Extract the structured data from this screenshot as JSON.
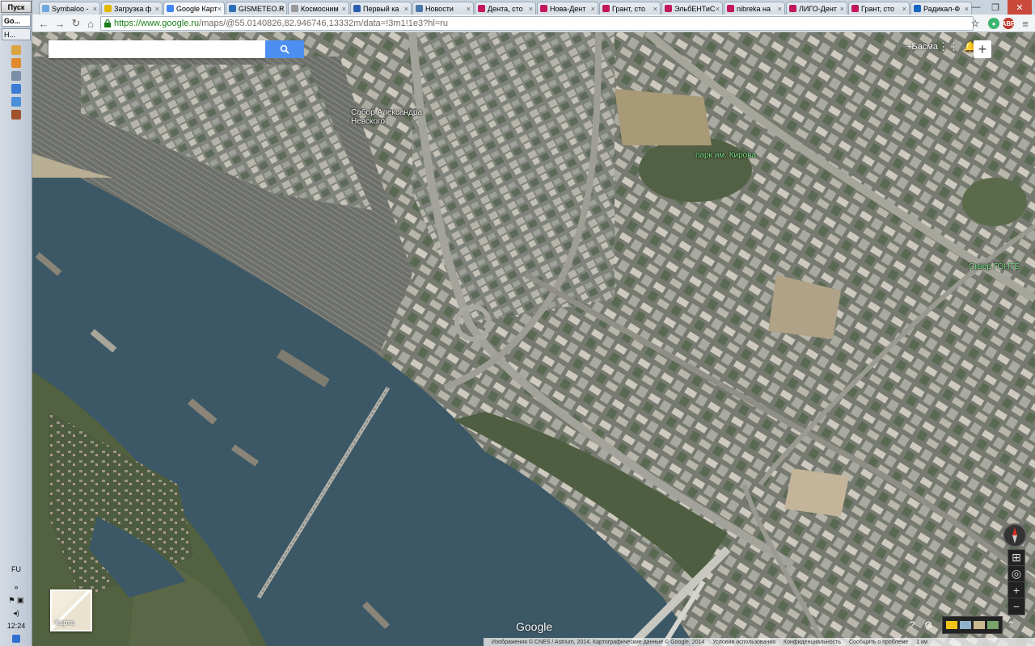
{
  "taskbar": {
    "start_label": "Пуск",
    "items": [
      {
        "label": "Go..."
      },
      {
        "label": "Н..."
      }
    ],
    "lang": "FU",
    "clock": "12:24"
  },
  "browser": {
    "tabs": [
      {
        "label": "Symbaloo -",
        "color": "#6fa8dc"
      },
      {
        "label": "Загрузка ф",
        "color": "#e6b800"
      },
      {
        "label": "Google Карт",
        "color": "#4285f4"
      },
      {
        "label": "GISMETEO.R",
        "color": "#2d6fb3"
      },
      {
        "label": "Космосним",
        "color": "#999999"
      },
      {
        "label": "Первый ка",
        "color": "#2a5db0"
      },
      {
        "label": "Новости",
        "color": "#4a76a8"
      },
      {
        "label": "Дента, сто",
        "color": "#c2185b"
      },
      {
        "label": "Нова-Дент",
        "color": "#c2185b"
      },
      {
        "label": "Грант, сто",
        "color": "#c2185b"
      },
      {
        "label": "ЭльбЕНТиС",
        "color": "#c2185b"
      },
      {
        "label": "nibreka на",
        "color": "#c2185b"
      },
      {
        "label": "ЛИГО-Дент",
        "color": "#c2185b"
      },
      {
        "label": "Грант, сто",
        "color": "#c2185b"
      },
      {
        "label": "Радикал-Ф",
        "color": "#1565c0"
      }
    ],
    "active_tab_index": 2,
    "url_host": "https://www.google.ru",
    "url_path": "/maps/@55.0140826,82.946746,13332m/data=!3m1!1e3?hl=ru",
    "ext_label": "ABP"
  },
  "map": {
    "search_placeholder": "",
    "account_name": "+Басма",
    "labels": {
      "cathedral": "Собор Александра\nНевского",
      "park": "парк им. Кирова",
      "square": "Сквер ГОНТБ"
    },
    "thumb_label": "Карта",
    "logo": "Google",
    "attribution": {
      "imagery": "Изображения © CNES / Astrium, 2014, Картографические данные © Google, 2014",
      "terms": "Условия использования",
      "privacy": "Конфиденциальность",
      "report": "Сообщить о проблеме",
      "scale": "1 км"
    },
    "colors": {
      "river": "#3c5866",
      "land_dark": "#55604f",
      "urban": "#8b8d86",
      "search_button": "#4d8ff0"
    }
  }
}
